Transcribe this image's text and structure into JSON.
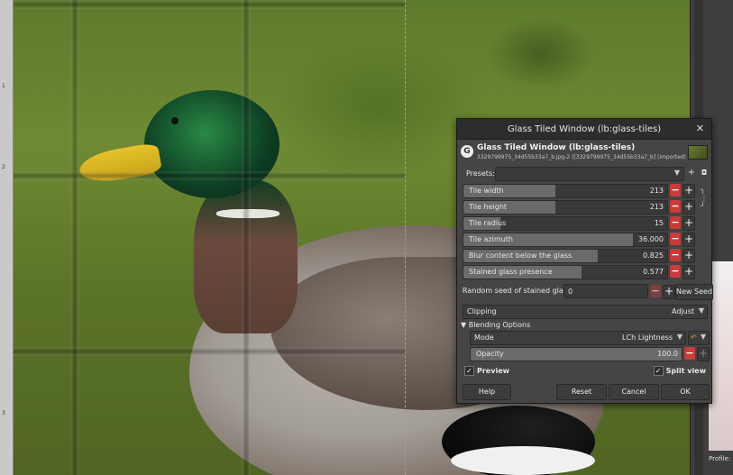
{
  "sidebar": {
    "profile_label": "Profile:"
  },
  "ruler": {
    "marks": [
      "1",
      "2",
      "3"
    ]
  },
  "dialog": {
    "window_title": "Glass Tiled Window (lb:glass-tiles)",
    "header_title": "Glass Tiled Window (lb:glass-tiles)",
    "header_subtitle": "3329799975_34d55b33a7_b.jpg-2 ([3329799975_34d55b33a7_b] (imported)",
    "presets_label": "Presets:",
    "sliders": [
      {
        "label": "Tile width",
        "value": "213",
        "fill": 0.45,
        "minus_active": true
      },
      {
        "label": "Tile height",
        "value": "213",
        "fill": 0.45,
        "minus_active": true
      },
      {
        "label": "Tile radius",
        "value": "15",
        "fill": 0.18,
        "minus_active": true
      },
      {
        "label": "Tile azimuth",
        "value": "36.000",
        "fill": 0.83,
        "minus_active": true
      },
      {
        "label": "Blur content below the glass",
        "value": "0.825",
        "fill": 0.66,
        "minus_active": true
      },
      {
        "label": "Stained glass presence",
        "value": "0.577",
        "fill": 0.58,
        "minus_active": true
      }
    ],
    "seed": {
      "label": "Random seed of stained glass",
      "value": "0",
      "new_seed_label": "New Seed"
    },
    "clipping": {
      "label": "Clipping",
      "value": "Adjust"
    },
    "blending": {
      "expander_label": "Blending Options",
      "mode_label": "Mode",
      "mode_value": "LCh Lightness",
      "opacity_label": "Opacity",
      "opacity_value": "100.0",
      "opacity_fill": 1.0
    },
    "preview_label": "Preview",
    "split_view_label": "Split view",
    "buttons": {
      "help": "Help",
      "reset": "Reset",
      "cancel": "Cancel",
      "ok": "OK"
    }
  },
  "colors": {
    "minus_red": "#c93b3b",
    "split_guide": "#e070e0"
  }
}
